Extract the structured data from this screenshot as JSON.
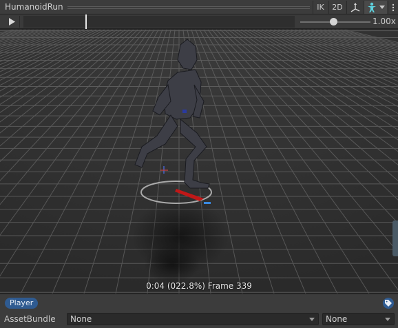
{
  "header": {
    "title": "HumanoidRun",
    "buttons": {
      "ik": "IK",
      "two_d": "2D"
    },
    "icons": [
      "pivot-gizmo-icon",
      "avatar-icon",
      "dropdown-arrow-icon",
      "more-menu-icon"
    ]
  },
  "timeline": {
    "play_icon": "play-icon",
    "speed_label": "1.00x",
    "speed_fraction": 0.42,
    "playhead_fraction": 0.23
  },
  "viewport": {
    "status_text": "0:04 (022.8%) Frame 339"
  },
  "footer": {
    "tag_label": "Player",
    "tag_icon": "label-icon",
    "assetbundle_label": "AssetBundle",
    "assetbundle_value": "None",
    "variant_value": "None"
  },
  "colors": {
    "accent_blue": "#2f5b91",
    "avatar_cyan": "#5fd3e0",
    "gizmo_red": "#c01818"
  }
}
